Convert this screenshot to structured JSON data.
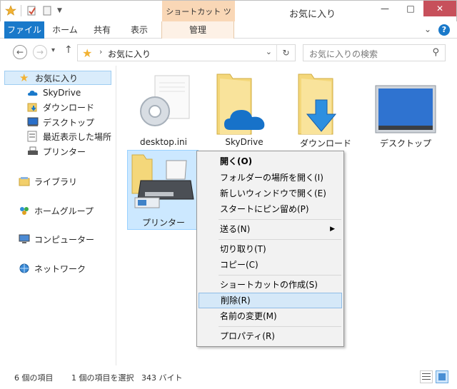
{
  "titlebar": {
    "context_tab_header": "ショートカット ツール",
    "window_title": "お気に入り",
    "minimize": "—",
    "maximize": "□",
    "close": "✕"
  },
  "ribbon": {
    "tabs": [
      "ファイル",
      "ホーム",
      "共有",
      "表示",
      "管理"
    ],
    "expand": "⌄",
    "help": "?"
  },
  "address": {
    "crumb": "お気に入り",
    "search_placeholder": "お気に入りの検索"
  },
  "sidebar": {
    "favorites": "お気に入り",
    "fav_items": [
      "SkyDrive",
      "ダウンロード",
      "デスクトップ",
      "最近表示した場所",
      "プリンター"
    ],
    "libraries": "ライブラリ",
    "homegroup": "ホームグループ",
    "computer": "コンピューター",
    "network": "ネットワーク"
  },
  "files": [
    {
      "label": "desktop.ini",
      "icon": "ini-gear-icon"
    },
    {
      "label": "SkyDrive",
      "icon": "skydrive-folder-icon"
    },
    {
      "label": "ダウンロード",
      "icon": "download-folder-icon"
    },
    {
      "label": "デスクトップ",
      "icon": "desktop-icon"
    },
    {
      "label": "プリンター",
      "icon": "printer-shortcut-icon"
    }
  ],
  "context_menu": {
    "open": "開く(O)",
    "open_location": "フォルダーの場所を開く(I)",
    "open_new_window": "新しいウィンドウで開く(E)",
    "pin_start": "スタートにピン留め(P)",
    "send_to": "送る(N)",
    "cut": "切り取り(T)",
    "copy": "コピー(C)",
    "create_shortcut": "ショートカットの作成(S)",
    "delete": "削除(R)",
    "rename": "名前の変更(M)",
    "properties": "プロパティ(R)"
  },
  "status": {
    "item_count": "6 個の項目",
    "selection": "1 個の項目を選択",
    "size": "343 バイト"
  },
  "colors": {
    "file_tab": "#1979ca",
    "context_tab": "#f9d7b6",
    "close_button": "#c7505b",
    "selection": "#cce8ff",
    "menu_hover": "#d5e8f8"
  }
}
